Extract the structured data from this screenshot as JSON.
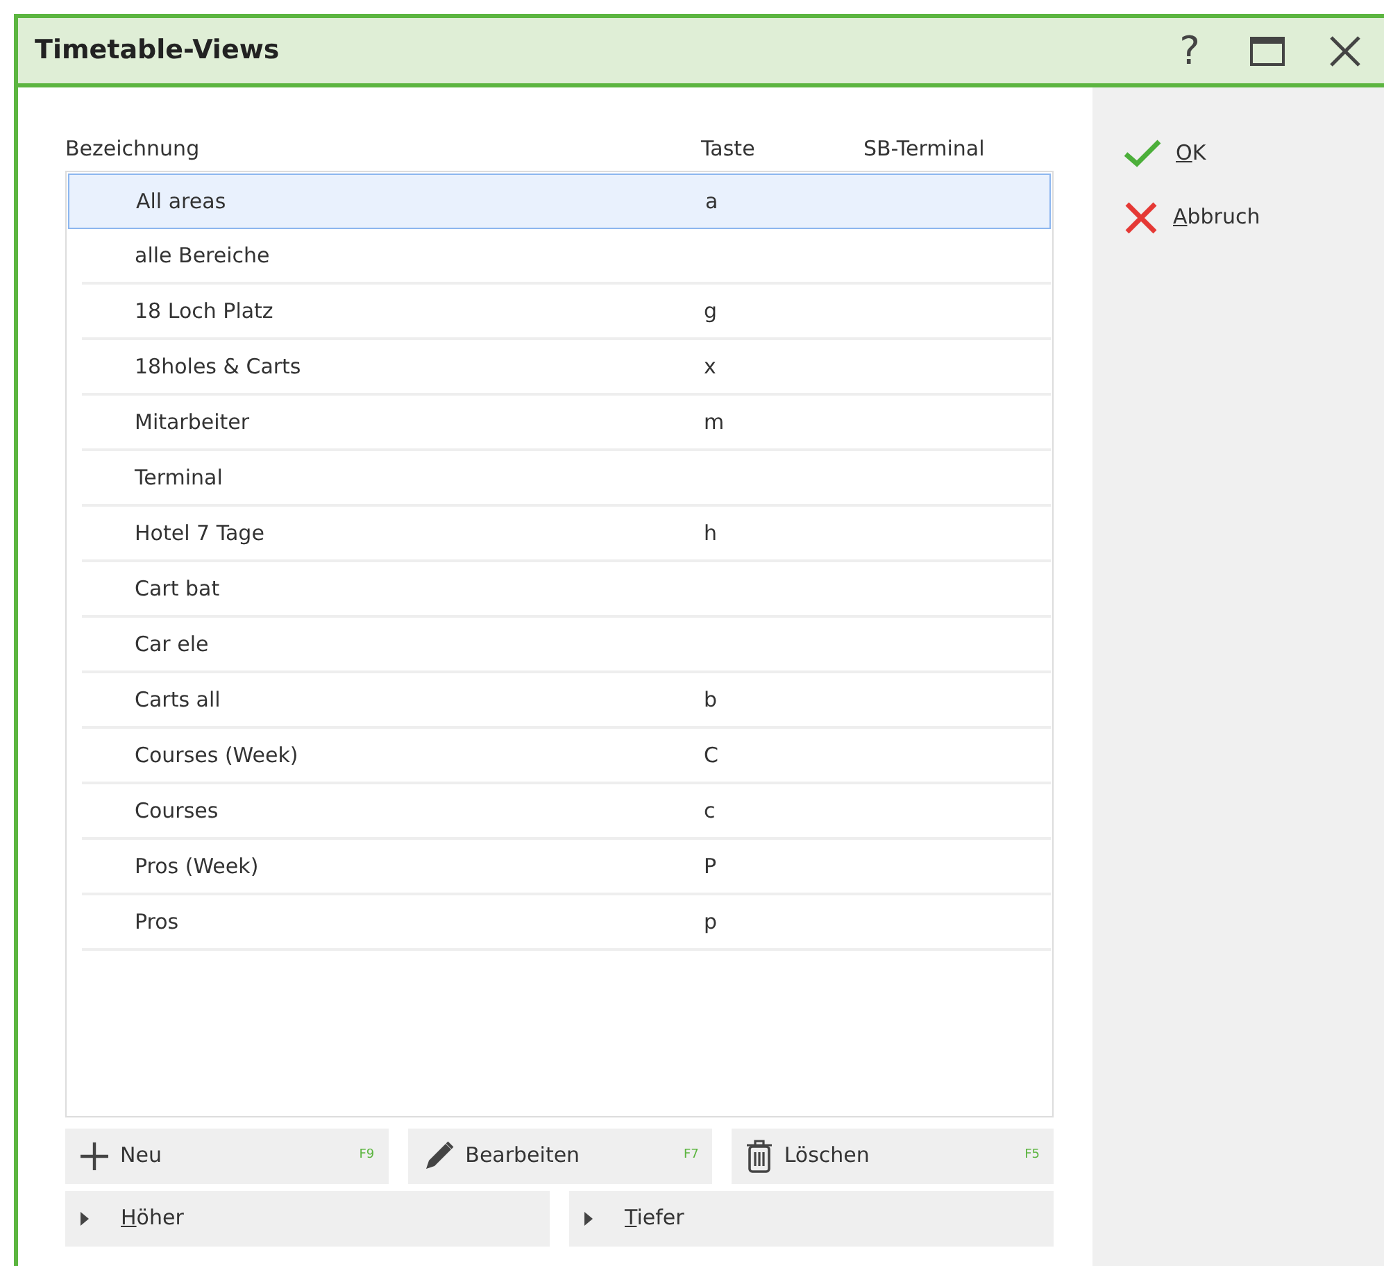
{
  "window": {
    "title": "Timetable-Views",
    "controls": [
      {
        "kind": "help",
        "label": "?"
      },
      {
        "kind": "maximize"
      },
      {
        "kind": "close"
      }
    ]
  },
  "table": {
    "columns": [
      "Bezeichnung",
      "Taste",
      "SB-Terminal"
    ],
    "rows": [
      {
        "name": "All areas",
        "key": "a",
        "selected": true
      },
      {
        "name": "alle Bereiche",
        "key": "",
        "selected": false
      },
      {
        "name": "18 Loch Platz",
        "key": "g",
        "selected": false
      },
      {
        "name": "18holes & Carts",
        "key": "x",
        "selected": false
      },
      {
        "name": "Mitarbeiter",
        "key": "m",
        "selected": false
      },
      {
        "name": "Terminal",
        "key": "",
        "selected": false
      },
      {
        "name": "Hotel 7 Tage",
        "key": "h",
        "selected": false
      },
      {
        "name": "Cart bat",
        "key": "",
        "selected": false
      },
      {
        "name": "Car ele",
        "key": "",
        "selected": false
      },
      {
        "name": "Carts all",
        "key": "b",
        "selected": false
      },
      {
        "name": "Courses (Week)",
        "key": "C",
        "selected": false
      },
      {
        "name": "Courses",
        "key": "c",
        "selected": false
      },
      {
        "name": "Pros (Week)",
        "key": "P",
        "selected": false
      },
      {
        "name": "Pros",
        "key": "p",
        "selected": false
      }
    ]
  },
  "actions": [
    {
      "kind": "new",
      "label": "Neu",
      "shortcut": "F9"
    },
    {
      "kind": "edit",
      "label": "Bearbeiten",
      "shortcut": "F7"
    },
    {
      "kind": "delete",
      "label": "Löschen",
      "shortcut": "F5"
    }
  ],
  "move_buttons": [
    {
      "accel": "H",
      "rest": "öher"
    },
    {
      "accel": "T",
      "rest": "iefer"
    }
  ],
  "side_buttons": [
    {
      "kind": "ok",
      "accel": "O",
      "rest": "K"
    },
    {
      "kind": "cancel",
      "accel": "A",
      "rest": "bbruch"
    }
  ]
}
